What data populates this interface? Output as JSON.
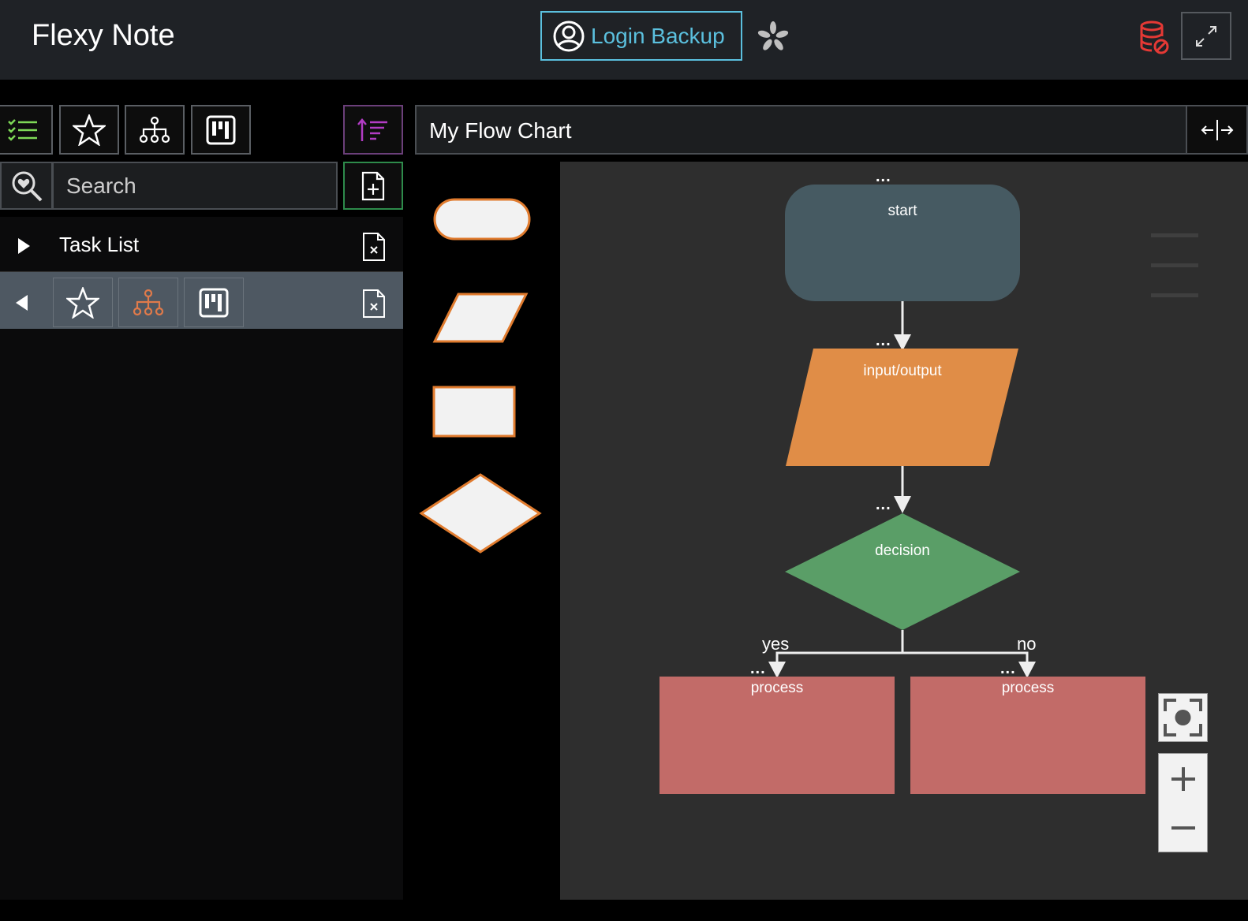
{
  "app": {
    "title": "Flexy Note"
  },
  "header": {
    "login_label": "Login Backup",
    "accent_color": "#5bc0de",
    "db_status_color": "#e53935"
  },
  "toolbar": {
    "icons": [
      "task-list-icon",
      "star-icon",
      "hierarchy-icon",
      "kanban-icon",
      "sort-icon"
    ]
  },
  "search": {
    "placeholder": "Search",
    "value": ""
  },
  "sidebar": {
    "items": [
      {
        "label": "Task List",
        "expanded": false
      },
      {
        "label": "",
        "expanded": true,
        "selected": true
      }
    ]
  },
  "document": {
    "title": "My Flow Chart"
  },
  "palette": {
    "shapes": [
      "terminal-shape",
      "input-output-shape",
      "process-shape",
      "decision-shape"
    ]
  },
  "flowchart": {
    "ellipsis": "...",
    "nodes": {
      "start": "start",
      "io": "input/output",
      "decision": "decision",
      "process_yes": "process",
      "process_no": "process"
    },
    "edges": {
      "yes": "yes",
      "no": "no"
    },
    "colors": {
      "start": "#465a62",
      "io": "#e08d47",
      "decision": "#5a9e67",
      "process": "#c26b68"
    }
  }
}
